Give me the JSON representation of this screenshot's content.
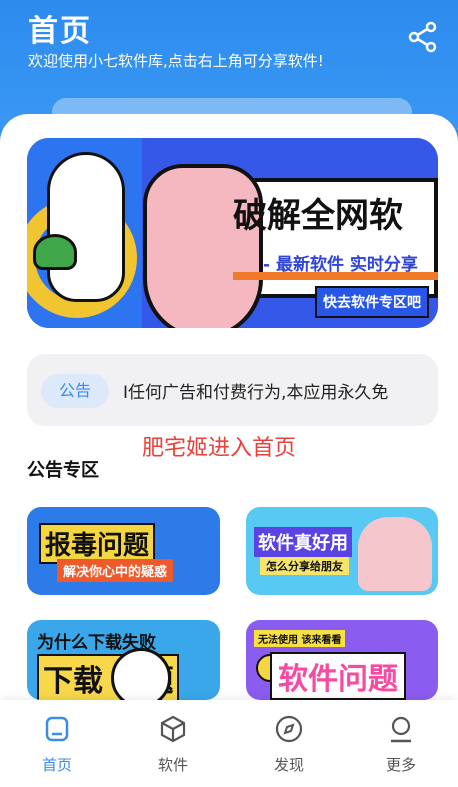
{
  "header": {
    "title": "首页",
    "subtitle": "欢迎使用小七软件库,点击右上角可分享软件!",
    "share_icon": "share-icon"
  },
  "banner": {
    "headline": "破解全网软",
    "subline": "- 最新软件 实时分享",
    "cta": "快去软件专区吧"
  },
  "notice": {
    "tag": "公告",
    "text": "I任何广告和付费行为,本应用永久免"
  },
  "overlay_text": "肥宅姬进入首页",
  "section": {
    "title": "公告专区"
  },
  "cards": {
    "card1": {
      "main": "报毒问题",
      "sub": "解决你心中的疑惑"
    },
    "card2": {
      "main": "软件真好用",
      "sub": "怎么分享给朋友"
    },
    "card3": {
      "top": "为什么下载失败",
      "main": "下载 问题"
    },
    "card4": {
      "top": "无法使用 该来看看",
      "main": "软件问题"
    }
  },
  "nav": {
    "items": [
      {
        "label": "首页",
        "icon": "home-icon",
        "active": true
      },
      {
        "label": "软件",
        "icon": "cube-icon",
        "active": false
      },
      {
        "label": "发现",
        "icon": "compass-icon",
        "active": false
      },
      {
        "label": "更多",
        "icon": "profile-icon",
        "active": false
      }
    ]
  },
  "colors": {
    "accent": "#3a8bea",
    "header_bg": "#2c8bee",
    "overlay_red": "#e8403a"
  }
}
